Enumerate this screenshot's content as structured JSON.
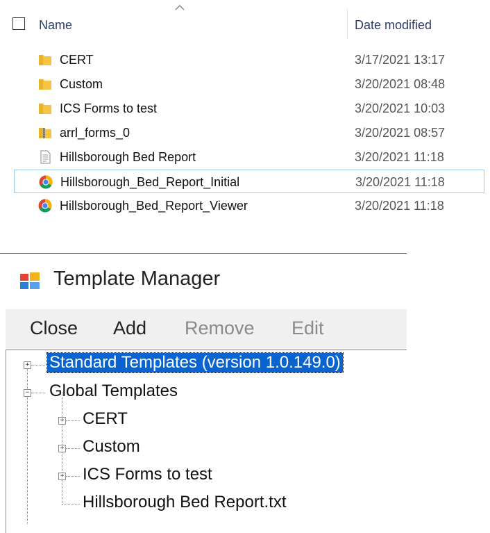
{
  "explorer": {
    "header": {
      "name_label": "Name",
      "date_label": "Date modified"
    },
    "files": [
      {
        "name": "CERT",
        "date": "3/17/2021 13:17",
        "icon": "folder-icon",
        "selected": false
      },
      {
        "name": "Custom",
        "date": "3/20/2021 08:48",
        "icon": "folder-icon",
        "selected": false
      },
      {
        "name": "ICS Forms to test",
        "date": "3/20/2021 10:03",
        "icon": "folder-icon",
        "selected": false
      },
      {
        "name": "arrl_forms_0",
        "date": "3/20/2021 08:57",
        "icon": "zip-folder-icon",
        "selected": false
      },
      {
        "name": "Hillsborough Bed Report",
        "date": "3/20/2021 11:18",
        "icon": "text-file-icon",
        "selected": false
      },
      {
        "name": "Hillsborough_Bed_Report_Initial",
        "date": "3/20/2021 11:18",
        "icon": "chrome-icon",
        "selected": true
      },
      {
        "name": "Hillsborough_Bed_Report_Viewer",
        "date": "3/20/2021 11:18",
        "icon": "chrome-icon",
        "selected": false
      }
    ]
  },
  "template_manager": {
    "title": "Template Manager",
    "toolbar": {
      "close_label": "Close",
      "add_label": "Add",
      "remove_label": "Remove",
      "edit_label": "Edit"
    },
    "tree": {
      "standard_templates": "Standard Templates (version 1.0.149.0)",
      "global_templates": "Global Templates",
      "children": [
        "CERT",
        "Custom",
        "ICS Forms to test",
        "Hillsborough Bed Report.txt"
      ]
    }
  },
  "colors": {
    "selection_blue": "#0a64d0",
    "row_selected_border": "#9cc9ef",
    "folder_yellow": "#f4c542"
  }
}
